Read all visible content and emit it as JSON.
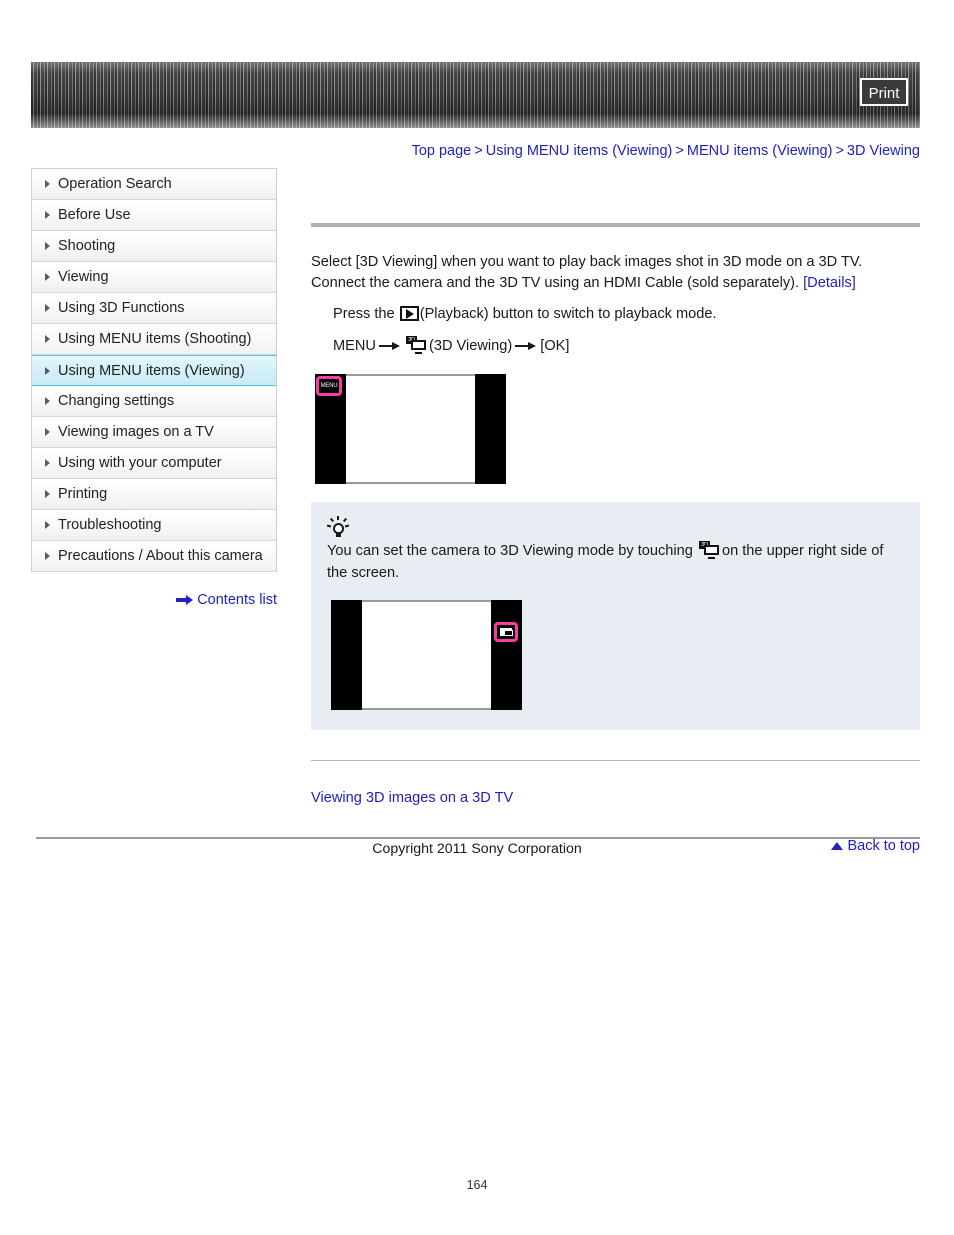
{
  "header": {
    "print_label": "Print"
  },
  "breadcrumb": {
    "separator": ">",
    "items": [
      {
        "label": "Top page"
      },
      {
        "label": "Using MENU items (Viewing)"
      },
      {
        "label": "MENU items (Viewing)"
      },
      {
        "label": "3D Viewing"
      }
    ]
  },
  "sidebar": {
    "items": [
      {
        "label": "Operation Search",
        "active": false
      },
      {
        "label": "Before Use",
        "active": false
      },
      {
        "label": "Shooting",
        "active": false
      },
      {
        "label": "Viewing",
        "active": false
      },
      {
        "label": "Using 3D Functions",
        "active": false
      },
      {
        "label": "Using MENU items (Shooting)",
        "active": false
      },
      {
        "label": "Using MENU items (Viewing)",
        "active": true
      },
      {
        "label": "Changing settings",
        "active": false
      },
      {
        "label": "Viewing images on a TV",
        "active": false
      },
      {
        "label": "Using with your computer",
        "active": false
      },
      {
        "label": "Printing",
        "active": false
      },
      {
        "label": "Troubleshooting",
        "active": false
      },
      {
        "label": "Precautions / About this camera",
        "active": false
      }
    ],
    "contents_list_label": "Contents list"
  },
  "main": {
    "intro_part1": "Select [3D Viewing] when you want to play back images shot in 3D mode on a 3D TV. Connect the camera and the 3D TV using an HDMI Cable (sold separately). ",
    "details_label": "[Details]",
    "step1_before": "Press the ",
    "step1_after": "(Playback) button to switch to playback mode.",
    "step2_menu": "MENU",
    "step2_middle": "(3D Viewing)",
    "step2_end": "[OK]",
    "menu_badge_label": "MENU",
    "tip_before": "You can set the camera to 3D Viewing mode by touching ",
    "tip_after": "on the upper right side of the screen.",
    "related_link_label": "Viewing 3D images on a 3D TV",
    "icon_3d_badge": "3D"
  },
  "footer": {
    "back_to_top_label": "Back to top",
    "copyright": "Copyright 2011 Sony Corporation",
    "page_number": "164"
  },
  "colors": {
    "link": "#2222bb",
    "marker": "#f43ea4",
    "active_nav": "#58c8e2",
    "tip_bg": "#e7edf2"
  }
}
